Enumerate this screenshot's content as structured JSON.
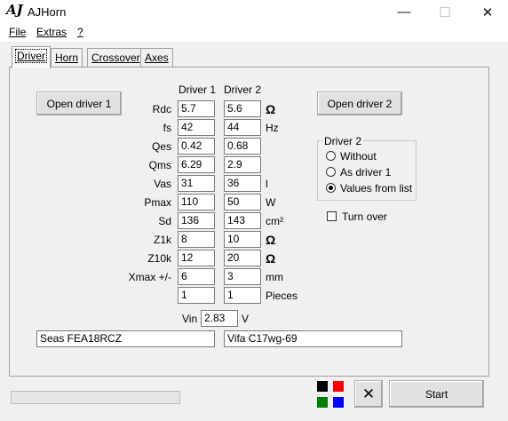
{
  "window": {
    "app_icon": "AJ",
    "title": "AJHorn",
    "minimize_glyph": "—",
    "maximize_glyph": "☐",
    "close_glyph": "✕"
  },
  "menu": {
    "file": "File",
    "extras": "Extras",
    "help": "?"
  },
  "tabs": [
    {
      "label": "Driver",
      "active": true
    },
    {
      "label": "Horn",
      "active": false
    },
    {
      "label": "Crossover",
      "active": false
    },
    {
      "label": "Axes",
      "active": false
    }
  ],
  "driver_panel": {
    "open_driver_1": "Open driver 1",
    "open_driver_2": "Open driver 2",
    "col1_header": "Driver 1",
    "col2_header": "Driver 2",
    "params": [
      {
        "label": "Rdc",
        "d1": "5.7",
        "d2": "5.6",
        "unit": "Ω"
      },
      {
        "label": "fs",
        "d1": "42",
        "d2": "44",
        "unit": "Hz"
      },
      {
        "label": "Qes",
        "d1": "0.42",
        "d2": "0.68",
        "unit": ""
      },
      {
        "label": "Qms",
        "d1": "6.29",
        "d2": "2.9",
        "unit": ""
      },
      {
        "label": "Vas",
        "d1": "31",
        "d2": "36",
        "unit": "l"
      },
      {
        "label": "Pmax",
        "d1": "110",
        "d2": "50",
        "unit": "W"
      },
      {
        "label": "Sd",
        "d1": "136",
        "d2": "143",
        "unit": "cm²"
      },
      {
        "label": "Z1k",
        "d1": "8",
        "d2": "10",
        "unit": "Ω"
      },
      {
        "label": "Z10k",
        "d1": "12",
        "d2": "20",
        "unit": "Ω"
      },
      {
        "label": "Xmax +/-",
        "d1": "6",
        "d2": "3",
        "unit": "mm"
      },
      {
        "label": "",
        "d1": "1",
        "d2": "1",
        "unit": "Pieces"
      }
    ],
    "vin_label": "Vin",
    "vin_value": "2.83",
    "vin_unit": "V",
    "driver1_name": "Seas FEA18RCZ",
    "driver2_name": "Vifa C17wg-69",
    "driver2_group": {
      "title": "Driver 2",
      "options": [
        "Without",
        "As driver 1",
        "Values from list"
      ],
      "selected": "Values from list"
    },
    "turn_over_label": "Turn over",
    "turn_over_checked": false
  },
  "footer": {
    "progress": 0,
    "colors": [
      "#000000",
      "#ff0000",
      "#008000",
      "#0000ff"
    ],
    "clear_icon": "✕",
    "start_label": "Start"
  }
}
